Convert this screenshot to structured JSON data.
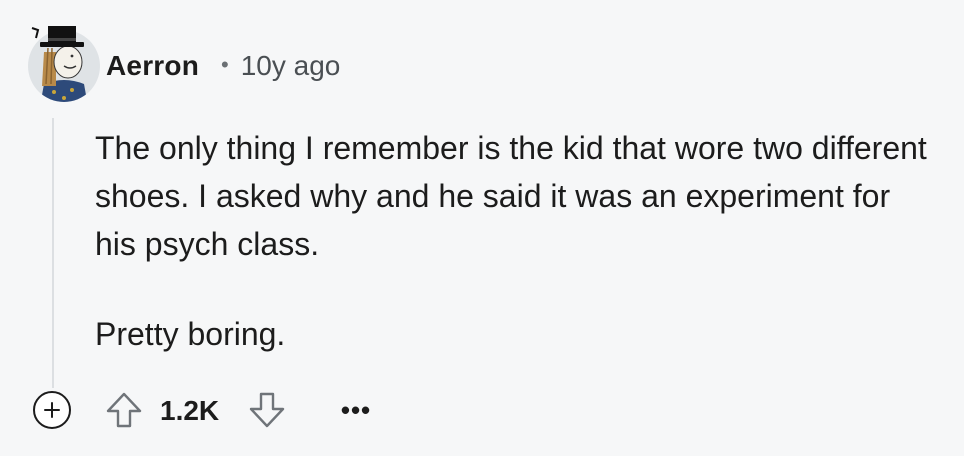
{
  "comment": {
    "author": "Aerron",
    "separator": "•",
    "timestamp": "10y ago",
    "paragraphs": [
      "The only thing I remember is the kid that wore two different shoes. I asked why and he said it was an experiment for his psych class.",
      "Pretty boring."
    ]
  },
  "actions": {
    "expand_icon": "plus-circle-icon",
    "upvote_icon": "arrow-up-outline-icon",
    "score": "1.2K",
    "downvote_icon": "arrow-down-outline-icon",
    "more_label": "•••"
  },
  "colors": {
    "background": "#f6f7f8",
    "text": "#1c1c1c",
    "muted": "#4a4f53",
    "thread_line": "#dcdfe2"
  }
}
